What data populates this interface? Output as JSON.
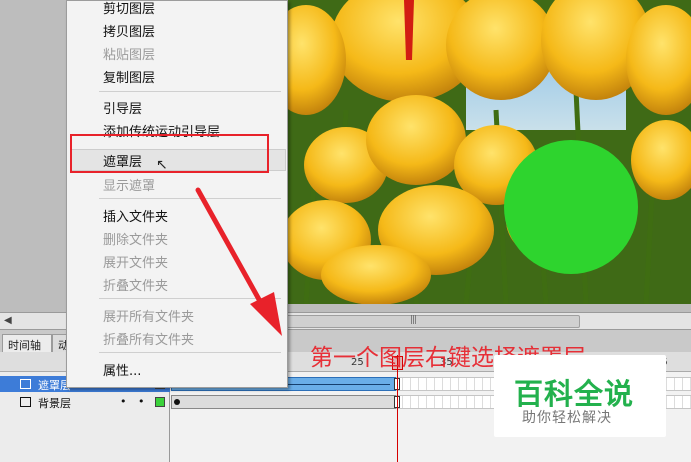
{
  "context_menu": {
    "items": [
      {
        "label": "剪切图层",
        "disabled": false
      },
      {
        "label": "拷贝图层",
        "disabled": false
      },
      {
        "label": "粘贴图层",
        "disabled": true
      },
      {
        "label": "复制图层",
        "disabled": false
      },
      {
        "label": "引导层",
        "disabled": false
      },
      {
        "label": "添加传统运动引导层",
        "disabled": false
      },
      {
        "label": "遮罩层",
        "disabled": false,
        "highlighted": true
      },
      {
        "label": "显示遮罩",
        "disabled": true
      },
      {
        "label": "插入文件夹",
        "disabled": false
      },
      {
        "label": "删除文件夹",
        "disabled": true
      },
      {
        "label": "展开文件夹",
        "disabled": true
      },
      {
        "label": "折叠文件夹",
        "disabled": true
      },
      {
        "label": "展开所有文件夹",
        "disabled": true
      },
      {
        "label": "折叠所有文件夹",
        "disabled": true
      },
      {
        "label": "属性...",
        "disabled": false
      }
    ]
  },
  "timeline": {
    "tabs": [
      "时间轴",
      "动"
    ],
    "ruler_ticks": [
      "25",
      "35",
      "45"
    ],
    "layers": [
      {
        "name": "遮罩层",
        "selected": true,
        "color": "#ff8a1c"
      },
      {
        "name": "背景层",
        "selected": false,
        "color": "#3bd23b"
      }
    ]
  },
  "annotation": {
    "text": "第一个图层右键选择遮罩层"
  },
  "watermark": {
    "title": "百科全说",
    "subtitle": "助你轻松解决"
  },
  "colors": {
    "accent_red": "#e8222a",
    "watermark_green": "#23b14d",
    "circle_green": "#2ed42e"
  },
  "icons": {
    "cursor": "arrow-cursor-icon",
    "scroll_left": "chevron-left-icon",
    "grip": "scroll-grip-icon"
  }
}
